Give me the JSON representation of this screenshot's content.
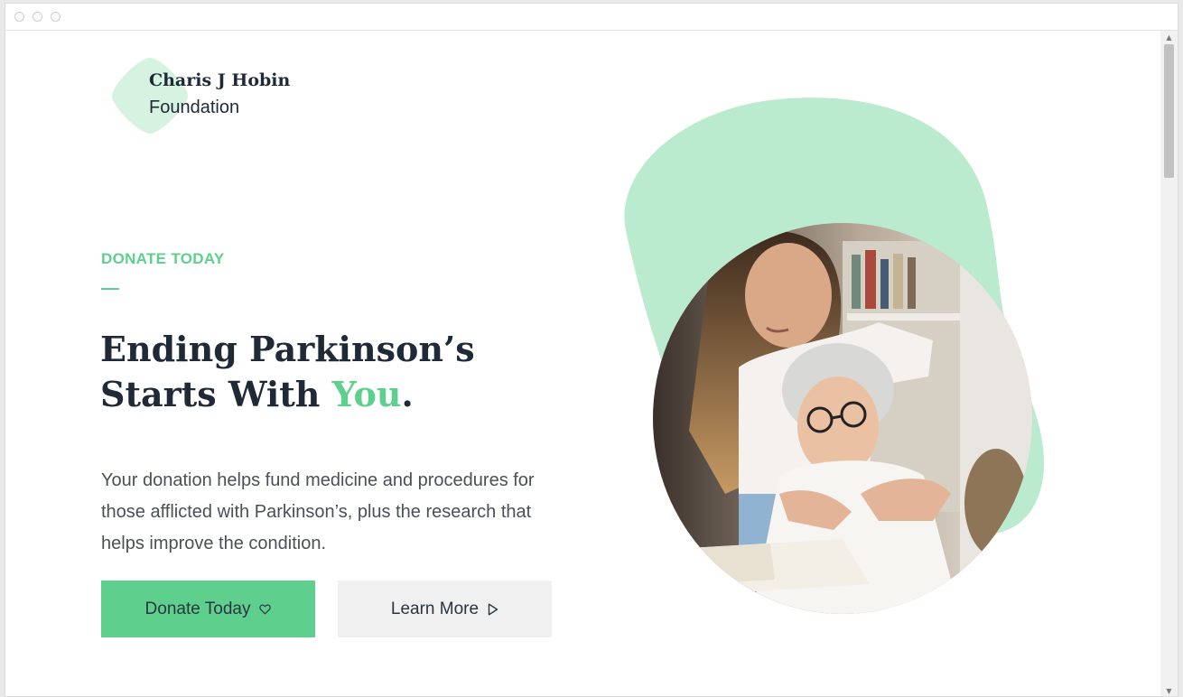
{
  "window": {
    "title": ""
  },
  "brand": {
    "line1": "Charis J Hobin",
    "line2": "Foundation",
    "accent_color": "#5fcf8e",
    "shape_color": "#d6f3e1"
  },
  "hero": {
    "eyebrow": "DONATE TODAY",
    "headline_part1": "Ending Parkinson’s Starts With ",
    "headline_accent": "You",
    "headline_end": ".",
    "body": "Your donation helps fund medicine and procedures for those afflicted with Parkinson’s, plus the research that helps improve the condition.",
    "blob_color": "#bbebcf",
    "photo_alt": "Young woman embracing an elderly woman reading a book"
  },
  "buttons": {
    "donate_label": "Donate Today",
    "donate_icon": "heart-icon",
    "learn_label": "Learn More",
    "learn_icon": "play-icon"
  },
  "colors": {
    "primary": "#5fcf8e",
    "text_dark": "#1f2a36",
    "button_secondary": "#f0f0f0"
  }
}
